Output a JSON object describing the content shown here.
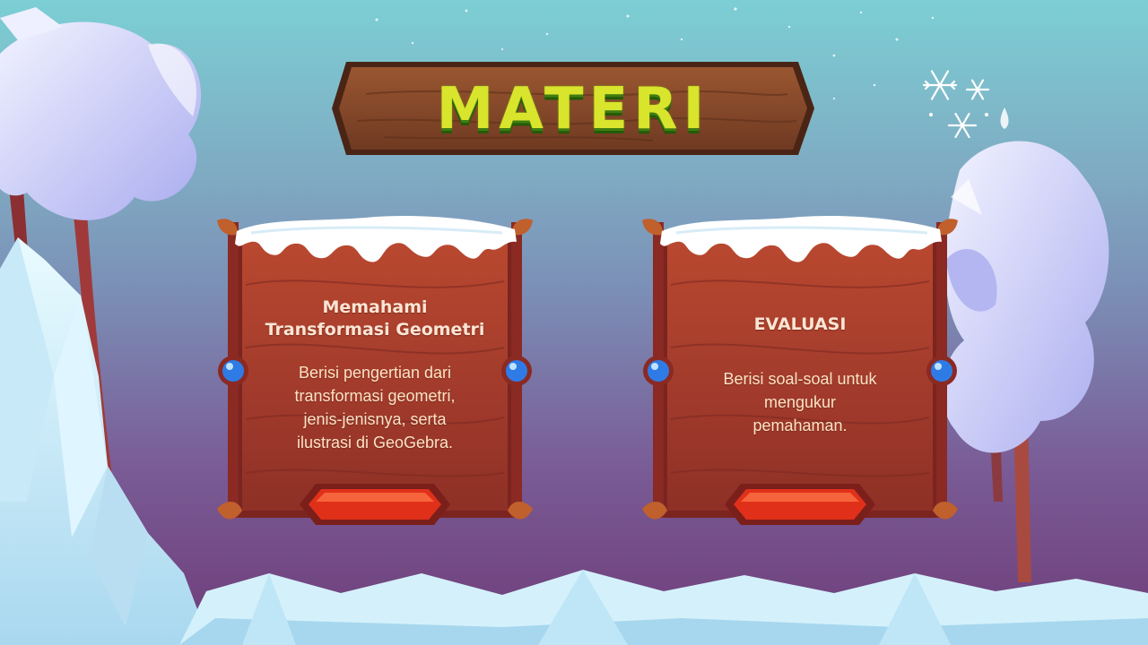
{
  "header": {
    "title": "MATERI"
  },
  "cards": [
    {
      "title_line1": "Memahami",
      "title_line2": "Transformasi Geometri",
      "description_lines": [
        "Berisi pengertian dari",
        "transformasi geometri,",
        "jenis-jenisnya, serta",
        "ilustrasi di GeoGebra."
      ]
    },
    {
      "title_line1": "EVALUASI",
      "description_lines": [
        "Berisi soal-soal untuk",
        "mengukur",
        "pemahaman."
      ]
    }
  ],
  "icons": {
    "gem": "blue-gem-icon",
    "snowflake": "snowflake-icon",
    "button": "red-gem-button"
  },
  "colors": {
    "title_fill": "#d9e42c",
    "title_shadow": "#3f7d12",
    "card_text": "#fbe5d4",
    "wood": "#a53e2c",
    "frame": "#8a2a23",
    "gem_blue": "#2f7be6",
    "button_red": "#e1301a"
  }
}
